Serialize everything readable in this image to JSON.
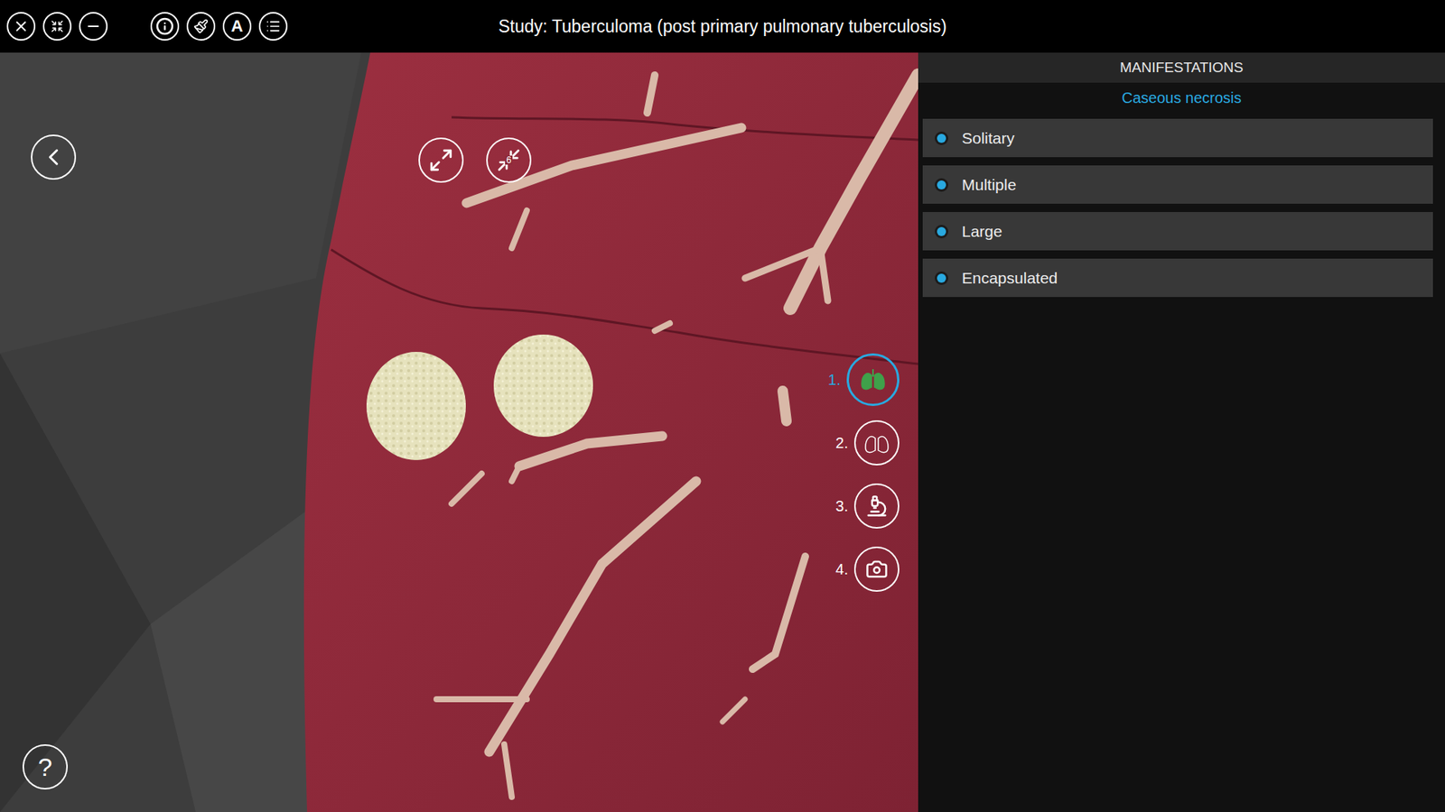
{
  "window": {
    "title": "Study: Tuberculoma (post primary pulmonary tuberculosis)"
  },
  "toolbar": {
    "text_button": "A"
  },
  "view_controls": {
    "zoom_badge": "6"
  },
  "steps": [
    {
      "label": "1.",
      "kind": "lungs",
      "selected": true
    },
    {
      "label": "2.",
      "kind": "lung",
      "selected": false
    },
    {
      "label": "3.",
      "kind": "microscope",
      "selected": false
    },
    {
      "label": "4.",
      "kind": "camera",
      "selected": false
    }
  ],
  "panel": {
    "header": "MANIFESTATIONS",
    "category": "Caseous necrosis",
    "items": [
      {
        "label": "Solitary",
        "checked": true
      },
      {
        "label": "Multiple",
        "checked": true
      },
      {
        "label": "Large",
        "checked": true
      },
      {
        "label": "Encapsulated",
        "checked": true
      }
    ]
  },
  "help": "?"
}
